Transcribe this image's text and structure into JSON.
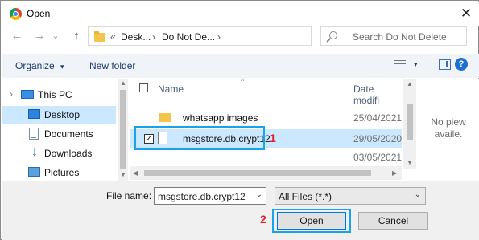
{
  "window": {
    "title": "Open",
    "close_glyph": "✕"
  },
  "nav": {
    "back_glyph": "←",
    "forward_glyph": "→",
    "recent_glyph": "⌄",
    "up_glyph": "↑",
    "breadcrumb_prefix": "«",
    "breadcrumbs": [
      "Desk...",
      "Do Not De..."
    ],
    "crumb_sep": "›",
    "address_dropdown_glyph": "⌄",
    "refresh_glyph": "↻",
    "search_placeholder": "Search Do Not Delete"
  },
  "toolbar": {
    "organize_label": "Organize",
    "organize_glyph": "▾",
    "new_folder_label": "New folder",
    "view_dropdown_glyph": "▾",
    "help_glyph": "?"
  },
  "sidebar": {
    "items": [
      {
        "label": "This PC",
        "icon": "pc-icon",
        "selected": false
      },
      {
        "label": "Desktop",
        "icon": "desktop-icon",
        "selected": true
      },
      {
        "label": "Documents",
        "icon": "documents-icon",
        "selected": false
      },
      {
        "label": "Downloads",
        "icon": "downloads-icon",
        "selected": false
      },
      {
        "label": "Pictures",
        "icon": "pictures-icon",
        "selected": false
      }
    ],
    "expand_glyph": "›",
    "download_glyph": "↓"
  },
  "filelist": {
    "columns": {
      "name": "Name",
      "date": "Date modifi"
    },
    "sort_glyph": "^",
    "rows": [
      {
        "name": "whatsapp images",
        "date": "25/04/2021",
        "type": "folder",
        "checked": false
      },
      {
        "name": "msgstore.db.crypt12",
        "date": "29/05/2020",
        "type": "file",
        "checked": true
      },
      {
        "name": "",
        "date": "03/05/2021",
        "type": "file",
        "checked": false
      }
    ],
    "check_glyph": "✓"
  },
  "preview": {
    "text_line1": "No piew",
    "text_line2": "availe."
  },
  "scroll": {
    "up": "▲",
    "down": "▼",
    "left": "◀",
    "right": "▶"
  },
  "bottom": {
    "filename_label": "File name:",
    "filename_value": "msgstore.db.crypt12",
    "filename_dropdown_glyph": "⌄",
    "filetype_value": "All Files (*.*)",
    "filetype_dropdown_glyph": "⌄",
    "open_label": "Open",
    "cancel_label": "Cancel"
  },
  "callouts": {
    "step1": "1",
    "step2": "2"
  },
  "colors": {
    "highlight": "#1aa3e8",
    "callout": "#e0202a",
    "selection": "#cce8ff",
    "accent": "#0078d7"
  }
}
